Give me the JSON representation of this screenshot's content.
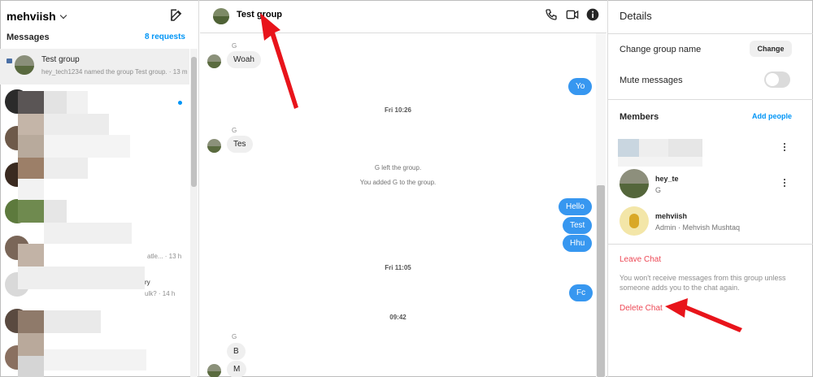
{
  "sidebar": {
    "account_name": "mehviish",
    "messages_title": "Messages",
    "requests_link": "8 requests",
    "active_thread": {
      "name": "Test group",
      "preview": "hey_tech1234 named the group Test group. · 13 m"
    },
    "fragments": {
      "frag_a": "atle... · 13 h",
      "frag_b": "ry",
      "frag_c": "ulk? · 14 h"
    }
  },
  "chat": {
    "title": "Test group",
    "messages": {
      "sender_g1": "G",
      "woah": "Woah",
      "yo": "Yo",
      "stamp1": "Fri 10:26",
      "sender_g2": "G",
      "tes": "Tes",
      "sys1": "G left the group.",
      "sys2": "You added G to the group.",
      "hello": "Hello",
      "test": "Test",
      "hhu": "Hhu",
      "stamp2": "Fri 11:05",
      "fc": "Fc",
      "stamp3": "09:42",
      "sender_g3": "G",
      "b": "B",
      "m": "M"
    }
  },
  "details": {
    "title": "Details",
    "change_group_name_label": "Change group name",
    "change_button": "Change",
    "mute_label": "Mute messages",
    "mute_on": false,
    "members_title": "Members",
    "add_people": "Add people",
    "members": [
      {
        "name": "hey_te",
        "sub": "G"
      },
      {
        "name": "mehviish",
        "sub": "Admin · Mehvish Mushtaq"
      }
    ],
    "leave_chat": "Leave Chat",
    "leave_note": "You won't receive messages from this group unless someone adds you to the chat again.",
    "delete_chat": "Delete Chat"
  },
  "colors": {
    "accent": "#0095f6",
    "bubble_out": "#3797f0",
    "danger": "#ed4956",
    "annotation": "#e8141b"
  }
}
